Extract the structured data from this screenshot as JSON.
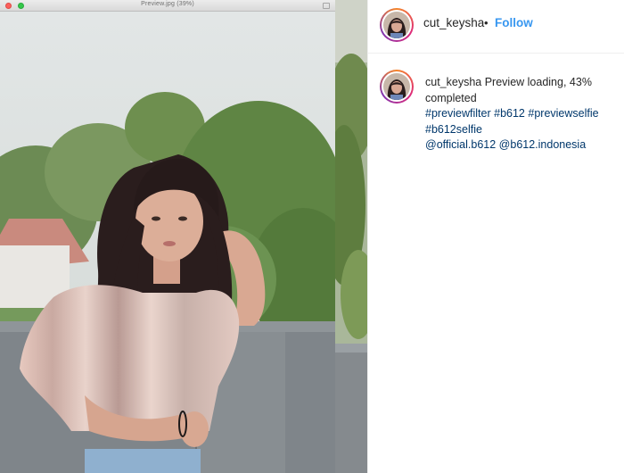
{
  "preview_window": {
    "title": "Preview.jpg (39%)"
  },
  "post": {
    "username": "cut_keysha",
    "separator": "•",
    "follow_label": "Follow"
  },
  "caption": {
    "username": "cut_keysha",
    "text": "Preview loading, 43% completed",
    "hashtags": [
      "#previewfilter",
      "#b612",
      "#previewselfie",
      "#b612selfie"
    ],
    "mentions": [
      "@official.b612",
      "@b612.indonesia"
    ]
  },
  "colors": {
    "accent": "#3897f0",
    "link": "#00376b",
    "text": "#262626",
    "divider": "#efefef"
  },
  "icons": {
    "window_close": "red-traffic-light-icon",
    "window_zoom": "green-traffic-light-icon"
  }
}
